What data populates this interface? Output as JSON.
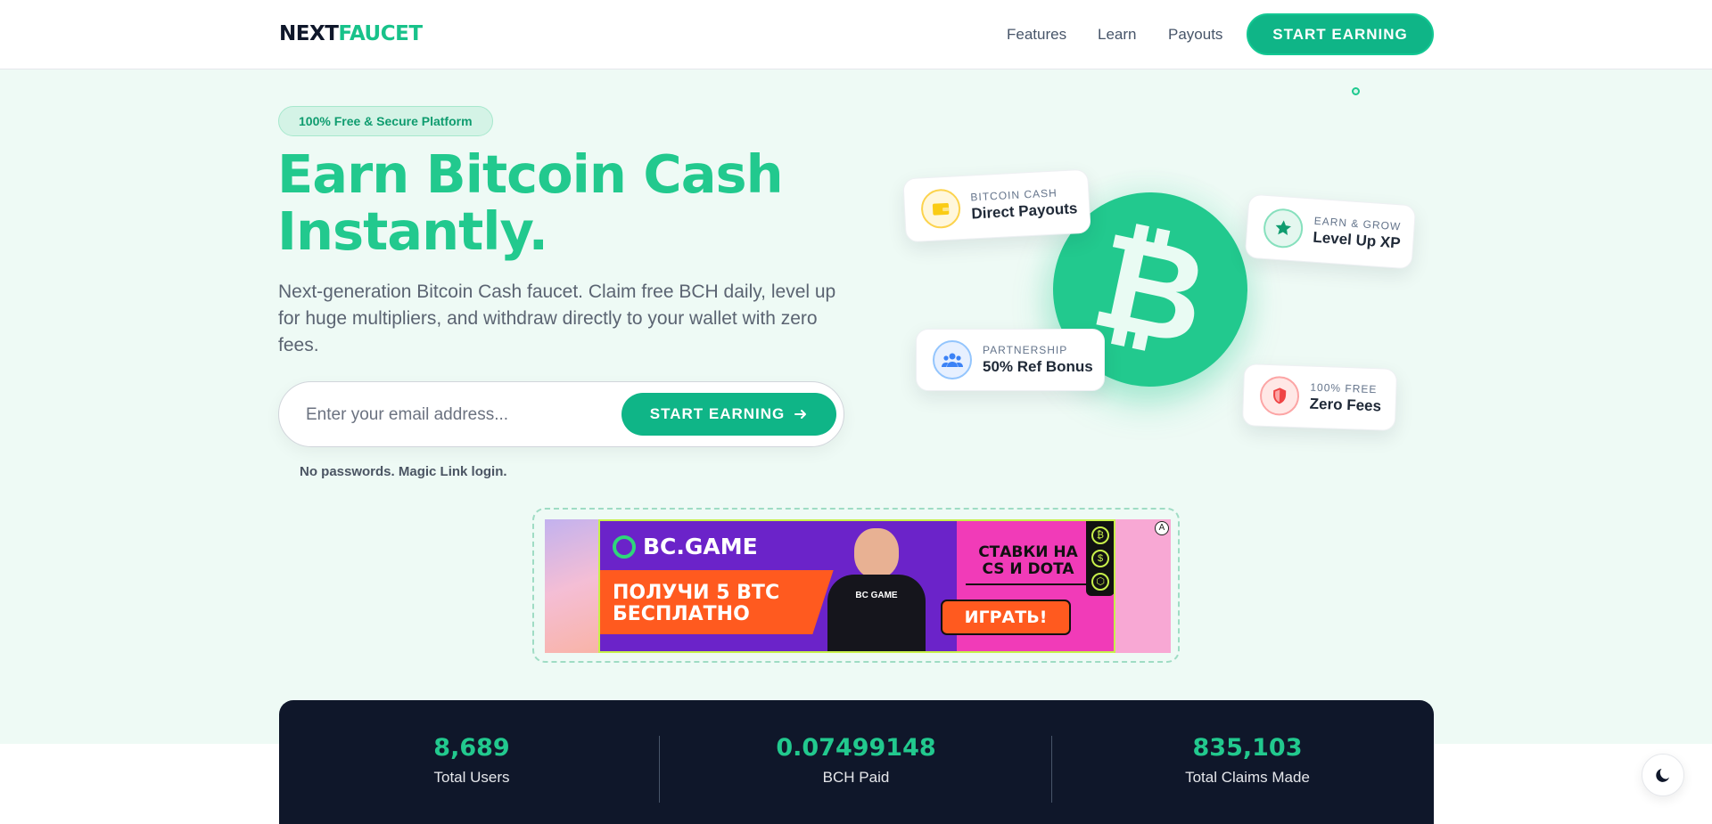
{
  "header": {
    "logo_part1": "NEXT",
    "logo_part2": "FAUCET",
    "nav": [
      "Features",
      "Learn",
      "Payouts"
    ],
    "cta_label": "START EARNING"
  },
  "hero": {
    "badge": "100% Free & Secure Platform",
    "title_line1": "Earn Bitcoin Cash",
    "title_line2": "Instantly.",
    "subtitle": "Next-generation Bitcoin Cash faucet. Claim free BCH daily, level up for huge multipliers, and withdraw directly to your wallet with zero fees.",
    "email_placeholder": "Enter your email address...",
    "cta_label": "START EARNING",
    "note": "No passwords. Magic Link login."
  },
  "ad": {
    "brand": "BC.GAME",
    "promo_line1": "ПОЛУЧИ 5 BTC",
    "promo_line2": "БЕСПЛАТНО",
    "shirt_label": "BC GAME",
    "headline_line1": "СТАВКИ НА",
    "headline_line2": "CS И DOTA",
    "button": "ИГРАТЬ!"
  },
  "features": [
    {
      "kicker": "BITCOIN CASH",
      "title": "Direct Payouts",
      "icon": "wallet-icon"
    },
    {
      "kicker": "EARN & GROW",
      "title": "Level Up XP",
      "icon": "star-icon"
    },
    {
      "kicker": "PARTNERSHIP",
      "title": "50% Ref Bonus",
      "icon": "users-icon"
    },
    {
      "kicker": "100% FREE",
      "title": "Zero Fees",
      "icon": "shield-icon"
    }
  ],
  "coin_symbol": "₿",
  "stats": [
    {
      "value": "8,689",
      "label": "Total Users"
    },
    {
      "value": "0.07499148",
      "label": "BCH Paid"
    },
    {
      "value": "835,103",
      "label": "Total Claims Made"
    }
  ],
  "colors": {
    "accent": "#22c98e",
    "button": "#0fb587",
    "dark": "#0f172a",
    "hero_bg": "#eefaf5"
  }
}
